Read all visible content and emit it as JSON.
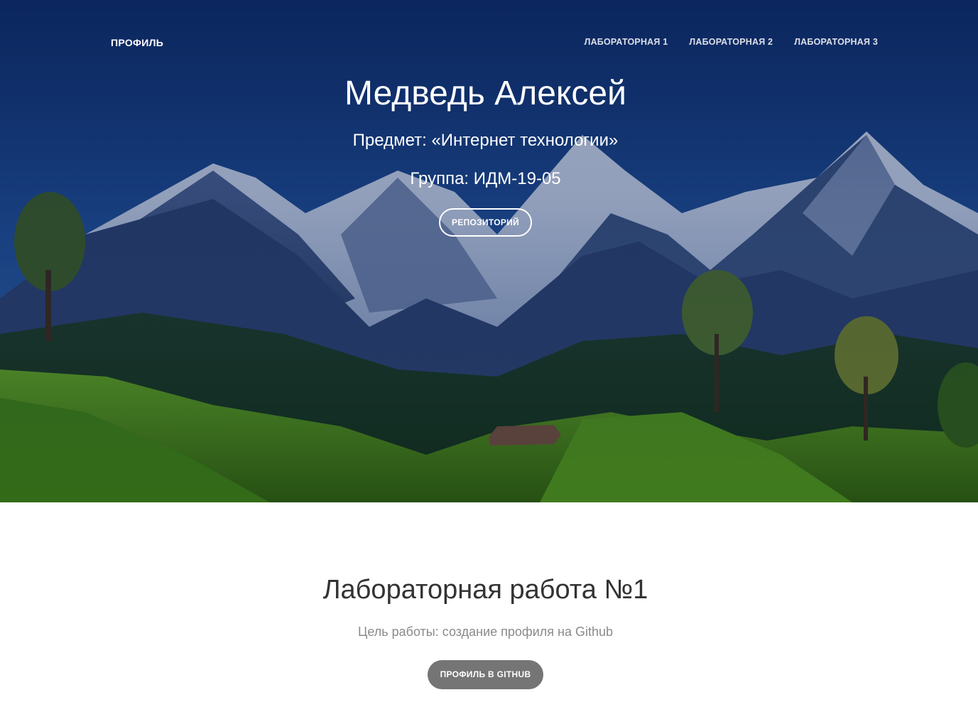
{
  "nav": {
    "brand": "ПРОФИЛЬ",
    "links": [
      {
        "label": "ЛАБОРАТОРНАЯ 1"
      },
      {
        "label": "ЛАБОРАТОРНАЯ 2"
      },
      {
        "label": "ЛАБОРАТОРНАЯ 3"
      }
    ]
  },
  "hero": {
    "name": "Медведь Алексей",
    "subject": "Предмет: «Интернет технологии»",
    "group": "Группа: ИДМ-19-05",
    "button_label": "РЕПОЗИТОРИЙ",
    "background": "mountain-landscape-image"
  },
  "section": {
    "title": "Лабораторная работа №1",
    "description": "Цель работы: создание профиля на Github",
    "button_label": "ПРОФИЛЬ В GITHUB"
  },
  "colors": {
    "hero_overlay": "#12346e",
    "section_title": "#333333",
    "section_desc": "#8a8a8a",
    "github_button": "#757575"
  }
}
